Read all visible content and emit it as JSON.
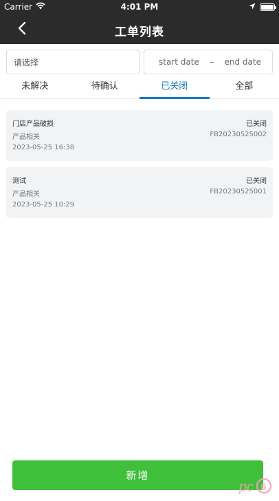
{
  "status_bar": {
    "carrier": "Carrier",
    "time": "4:01 PM"
  },
  "nav": {
    "title": "工单列表"
  },
  "filters": {
    "select_placeholder": "请选择",
    "start_date": "start date",
    "separator": "–",
    "end_date": "end date"
  },
  "tabs": [
    {
      "label": "未解决"
    },
    {
      "label": "待确认"
    },
    {
      "label": "已关闭"
    },
    {
      "label": "全部"
    }
  ],
  "active_tab": "已关闭",
  "tickets": [
    {
      "title": "门店产品破损",
      "status": "已关闭",
      "category": "产品相关",
      "code": "FB20230525002",
      "time": "2023-05-25 16:38"
    },
    {
      "title": "测试",
      "status": "已关闭",
      "category": "产品相关",
      "code": "FB20230525001",
      "time": "2023-05-25 10:29"
    }
  ],
  "add_button": {
    "label": "新增"
  },
  "watermark": {
    "text": "pc6"
  },
  "colors": {
    "nav_bg": "#2b2b2b",
    "accent": "#1677c4",
    "primary_button": "#3fbf3a",
    "card_bg": "#f2f3f5"
  },
  "icons": [
    "wifi-icon",
    "location-arrow-icon",
    "battery-icon",
    "back-chevron-icon"
  ]
}
